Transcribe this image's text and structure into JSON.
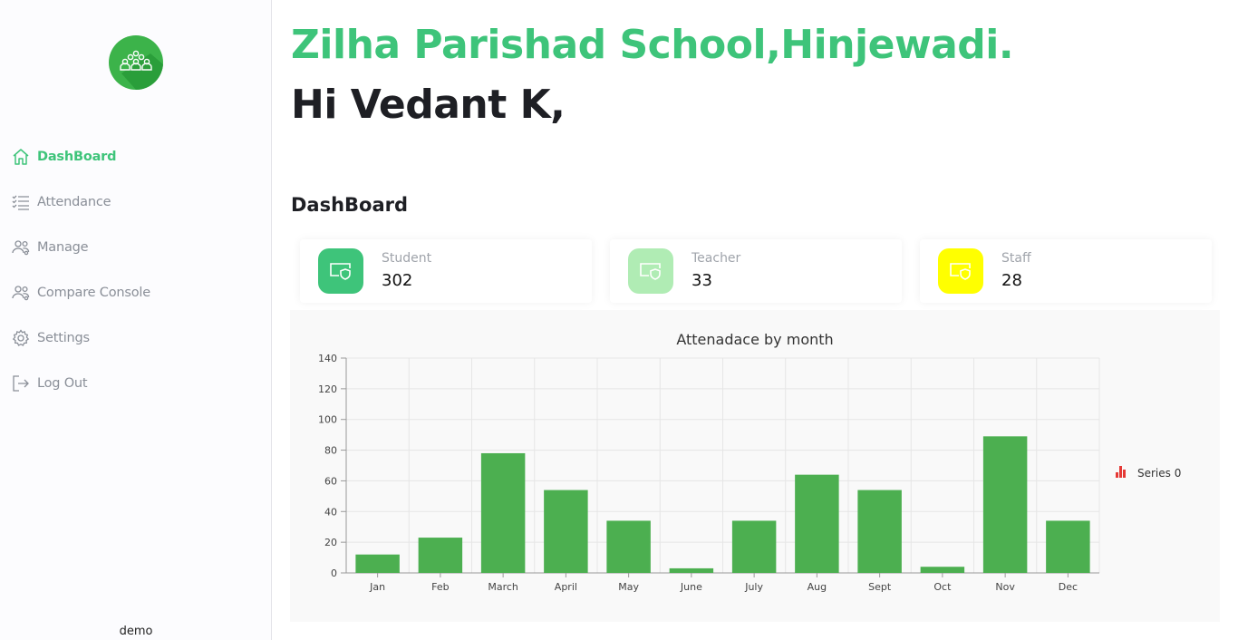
{
  "sidebar": {
    "logo_icon": "people-group-icon",
    "items": [
      {
        "label": "DashBoard",
        "icon": "home-icon",
        "active": true
      },
      {
        "label": "Attendance",
        "icon": "checklist-icon",
        "active": false
      },
      {
        "label": "Manage",
        "icon": "users-manage-icon",
        "active": false
      },
      {
        "label": "Compare Console",
        "icon": "users-compare-icon",
        "active": false
      },
      {
        "label": "Settings",
        "icon": "gear-icon",
        "active": false
      },
      {
        "label": "Log Out",
        "icon": "logout-icon",
        "active": false
      }
    ],
    "footer": "demo"
  },
  "header": {
    "school_name": "Zilha Parishad School,Hinjewadi.",
    "greeting": "Hi Vedant K,"
  },
  "dashboard": {
    "title": "DashBoard",
    "cards": [
      {
        "label": "Student",
        "value": "302",
        "color": "#3ec47a",
        "icon": "shield-screen-icon"
      },
      {
        "label": "Teacher",
        "value": "33",
        "color": "#b0ecb4",
        "icon": "shield-screen-icon"
      },
      {
        "label": "Staff",
        "value": "28",
        "color": "#ffff00",
        "icon": "shield-screen-icon"
      }
    ]
  },
  "colors": {
    "accent": "#3ec47a",
    "bar": "#4caf50",
    "legend_icon": "#e53935"
  },
  "chart_data": {
    "type": "bar",
    "title": "Attenadace by month",
    "categories": [
      "Jan",
      "Feb",
      "March",
      "April",
      "May",
      "June",
      "July",
      "Aug",
      "Sept",
      "Oct",
      "Nov",
      "Dec"
    ],
    "series": [
      {
        "name": "Series 0",
        "values": [
          12,
          23,
          78,
          54,
          34,
          3,
          34,
          64,
          54,
          4,
          89,
          34
        ]
      }
    ],
    "xlabel": "",
    "ylabel": "",
    "ylim": [
      0,
      140
    ],
    "yticks": [
      0,
      20,
      40,
      60,
      80,
      100,
      120,
      140
    ],
    "grid": true,
    "legend": "right"
  }
}
